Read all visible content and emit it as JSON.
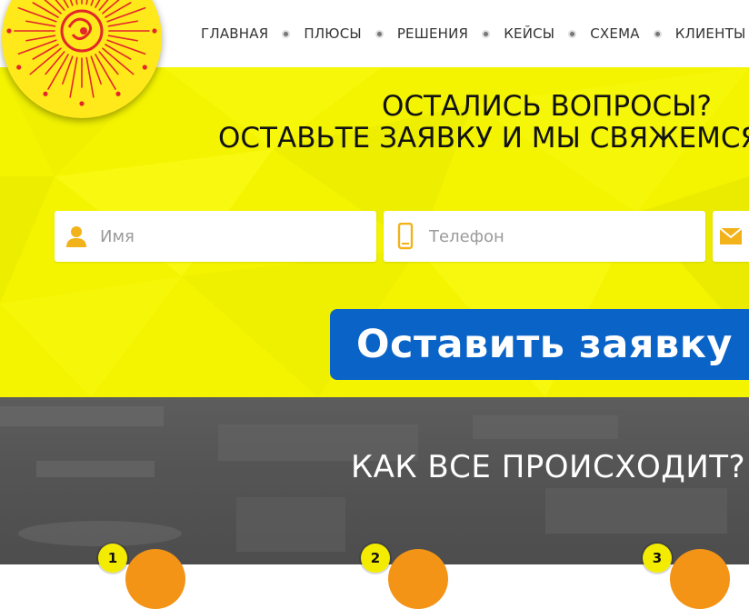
{
  "nav": {
    "items": [
      {
        "label": "ГЛАВНАЯ"
      },
      {
        "label": "ПЛЮСЫ"
      },
      {
        "label": "РЕШЕНИЯ"
      },
      {
        "label": "КЕЙСЫ"
      },
      {
        "label": "СХЕМА"
      },
      {
        "label": "КЛИЕНТЫ"
      }
    ]
  },
  "hero": {
    "title_line1": "ОСТАЛИСЬ ВОПРОСЫ?",
    "title_line2": "ОСТАВЬТЕ ЗАЯВКУ И МЫ СВЯЖЕМСЯ",
    "name_placeholder": "Имя",
    "phone_placeholder": "Телефон",
    "submit_label": "Оставить заявку"
  },
  "process": {
    "title": "КАК ВСЕ ПРОИСХОДИТ?",
    "steps": [
      {
        "number": "1"
      },
      {
        "number": "2"
      },
      {
        "number": "3"
      }
    ]
  },
  "colors": {
    "brand_yellow": "#f4f400",
    "button_blue": "#0a63c6",
    "step_orange": "#f39416",
    "logo_red": "#e3262b"
  },
  "icons": {
    "logo": "sun-logo-icon",
    "name": "user-icon",
    "phone": "phone-icon",
    "email": "envelope-icon",
    "nav_separator": "dot-icon"
  }
}
